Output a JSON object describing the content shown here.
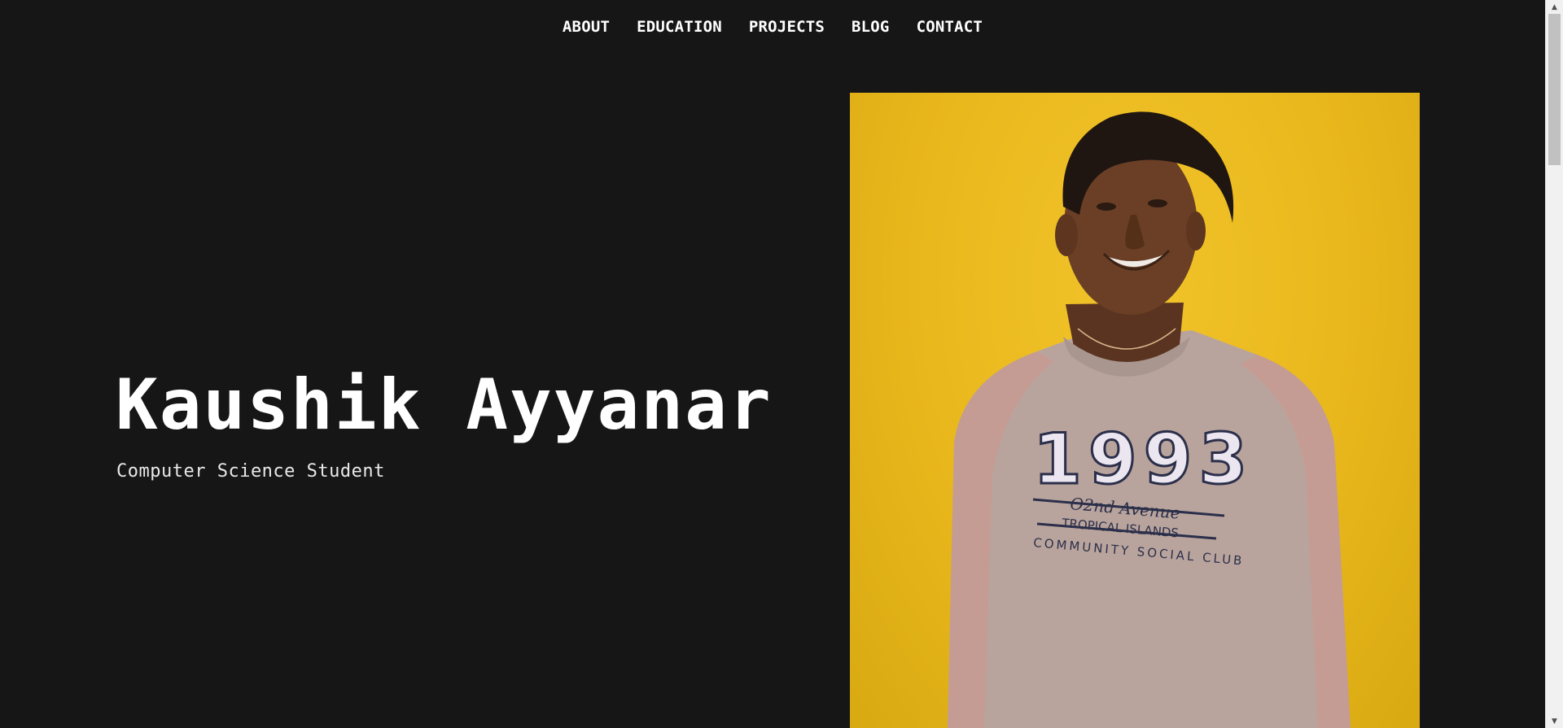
{
  "nav": {
    "items": [
      {
        "label": "ABOUT"
      },
      {
        "label": "EDUCATION"
      },
      {
        "label": "PROJECTS"
      },
      {
        "label": "BLOG"
      },
      {
        "label": "CONTACT"
      }
    ]
  },
  "hero": {
    "name": "Kaushik Ayyanar",
    "subtitle": "Computer Science Student"
  },
  "portrait": {
    "background_color": "#f0c020",
    "shirt_print": {
      "year": "1993",
      "line1": "02nd Avenue",
      "line2": "TROPICAL ISLANDS",
      "line3": "COMMUNITY SOCIAL CLUB"
    }
  },
  "colors": {
    "page_background": "#161616",
    "text": "#ffffff",
    "accent": "#f0c020"
  },
  "scrollbar": {
    "up_icon": "triangle-up",
    "down_icon": "triangle-down"
  }
}
